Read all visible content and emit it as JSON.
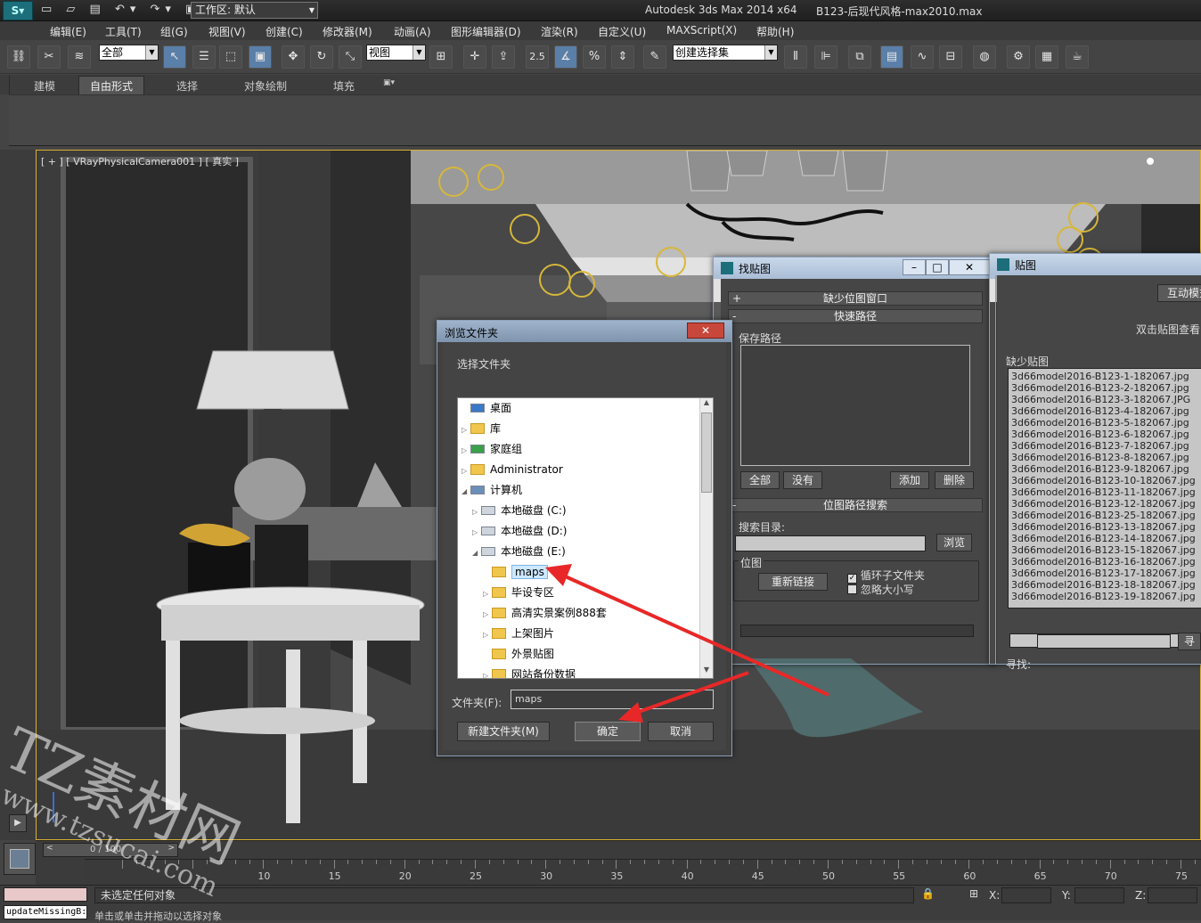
{
  "app": {
    "title": "Autodesk 3ds Max  2014 x64",
    "file": "B123-后现代风格-max2010.max",
    "workspace": "工作区: 默认"
  },
  "menus": [
    "编辑(E)",
    "工具(T)",
    "组(G)",
    "视图(V)",
    "创建(C)",
    "修改器(M)",
    "动画(A)",
    "图形编辑器(D)",
    "渲染(R)",
    "自定义(U)",
    "MAXScript(X)",
    "帮助(H)"
  ],
  "toolbar": {
    "filter": "全部",
    "refcoord": "视图",
    "snap_angle": "2.5",
    "percent": "%",
    "selection_set": "创建选择集"
  },
  "ribbon_tabs": [
    "建模",
    "自由形式",
    "选择",
    "对象绘制",
    "填充"
  ],
  "viewport": {
    "label": "[ + ] [ VRayPhysicalCamera001 ] [ 真实 ]"
  },
  "browse": {
    "title": "浏览文件夹",
    "prompt": "选择文件夹",
    "tree": [
      {
        "label": "桌面",
        "kind": "desktop",
        "depth": 0,
        "exp": ""
      },
      {
        "label": "库",
        "kind": "folder",
        "depth": 0,
        "exp": "▷"
      },
      {
        "label": "家庭组",
        "kind": "home",
        "depth": 0,
        "exp": "▷"
      },
      {
        "label": "Administrator",
        "kind": "folder",
        "depth": 0,
        "exp": "▷"
      },
      {
        "label": "计算机",
        "kind": "pc",
        "depth": 0,
        "exp": "◢"
      },
      {
        "label": "本地磁盘 (C:)",
        "kind": "drive",
        "depth": 1,
        "exp": "▷"
      },
      {
        "label": "本地磁盘 (D:)",
        "kind": "drive",
        "depth": 1,
        "exp": "▷"
      },
      {
        "label": "本地磁盘 (E:)",
        "kind": "drive",
        "depth": 1,
        "exp": "◢"
      },
      {
        "label": "maps",
        "kind": "folder",
        "depth": 2,
        "exp": "",
        "selected": true
      },
      {
        "label": "毕设专区",
        "kind": "folder",
        "depth": 2,
        "exp": "▷"
      },
      {
        "label": "高清实景案例888套",
        "kind": "folder",
        "depth": 2,
        "exp": "▷"
      },
      {
        "label": "上架图片",
        "kind": "folder",
        "depth": 2,
        "exp": "▷"
      },
      {
        "label": "外景贴图",
        "kind": "folder",
        "depth": 2,
        "exp": ""
      },
      {
        "label": "网站备份数据",
        "kind": "folder",
        "depth": 2,
        "exp": "▷"
      }
    ],
    "folder_label": "文件夹(F):",
    "folder_value": "maps",
    "new_folder": "新建文件夹(M)",
    "ok": "确定",
    "cancel": "取消"
  },
  "findmap": {
    "title": "找贴图",
    "rollout_missing": "缺少位图窗口",
    "rollout_quick": "快速路径",
    "save_path": "保存路径",
    "btn_all": "全部",
    "btn_none": "没有",
    "btn_add": "添加",
    "btn_delete": "删除",
    "rollout_search": "位图路径搜索",
    "search_dir": "搜索目录:",
    "btn_browse": "浏览",
    "bitmap_group": "位图",
    "btn_relink": "重新链接",
    "chk_recurse": "循环子文件夹",
    "chk_recurse_on": true,
    "chk_ignore_case": "忽略大小写",
    "chk_ignore_case_on": false
  },
  "maps": {
    "title": "贴图",
    "interactive": "互动模式",
    "hint": "双击贴图查看",
    "missing_label": "缺少贴图",
    "missing": [
      "3d66model2016-B123-1-182067.jpg",
      "3d66model2016-B123-2-182067.jpg",
      "3d66model2016-B123-3-182067.JPG",
      "3d66model2016-B123-4-182067.jpg",
      "3d66model2016-B123-5-182067.jpg",
      "3d66model2016-B123-6-182067.jpg",
      "3d66model2016-B123-7-182067.jpg",
      "3d66model2016-B123-8-182067.jpg",
      "3d66model2016-B123-9-182067.jpg",
      "3d66model2016-B123-10-182067.jpg",
      "3d66model2016-B123-11-182067.jpg",
      "3d66model2016-B123-12-182067.jpg",
      "3d66model2016-B123-25-182067.jpg",
      "3d66model2016-B123-13-182067.jpg",
      "3d66model2016-B123-14-182067.jpg",
      "3d66model2016-B123-15-182067.jpg",
      "3d66model2016-B123-16-182067.jpg",
      "3d66model2016-B123-17-182067.jpg",
      "3d66model2016-B123-18-182067.jpg",
      "3d66model2016-B123-19-182067.jpg"
    ],
    "find_label": "寻找:"
  },
  "timeline": {
    "frame": "0 / 100",
    "ticks": [
      "10",
      "15",
      "20",
      "25",
      "30",
      "35",
      "40",
      "45",
      "50",
      "55",
      "60",
      "65",
      "70",
      "75"
    ]
  },
  "status": {
    "selection": "未选定任何对象",
    "hint": "单击或单击并拖动以选择对象",
    "script": "updateMissingB:",
    "x": "X:",
    "y": "Y:",
    "z": "Z:"
  },
  "watermark": {
    "brand": "TZ素材网",
    "url": "www.tzsucai.com"
  },
  "colors": {
    "viewport_border": "#d8b030",
    "arrow": "#e82828",
    "selection": "#cde8ff"
  }
}
